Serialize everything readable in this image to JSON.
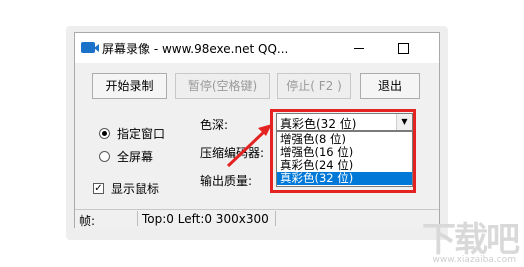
{
  "window": {
    "title": "屏幕录像 - www.98exe.net QQ..."
  },
  "toolbar": {
    "start_label": "开始录制",
    "pause_label": "暂停(空格键)",
    "stop_label": "停止( F2 )",
    "exit_label": "退出"
  },
  "capture_mode": {
    "window_label": "指定窗口",
    "fullscreen_label": "全屏幕",
    "selected": "指定窗口"
  },
  "show_cursor": {
    "label": "显示鼠标",
    "checked": true
  },
  "settings": {
    "color_depth_label": "色深:",
    "codec_label": "压缩编码器:",
    "quality_label": "输出质量:"
  },
  "color_depth": {
    "selected": "真彩色(32 位)",
    "options": [
      "增强色(8 位)",
      "增强色(16 位)",
      "真彩色(24 位)",
      "真彩色(32 位)"
    ]
  },
  "status": {
    "frames_label": "帧:",
    "geometry_text": "Top:0 Left:0 300x300"
  },
  "colors": {
    "highlight": "#e52222",
    "selection": "#0078d7"
  },
  "watermark": {
    "text": "下载吧",
    "url": "www.xiazaiba.com"
  }
}
